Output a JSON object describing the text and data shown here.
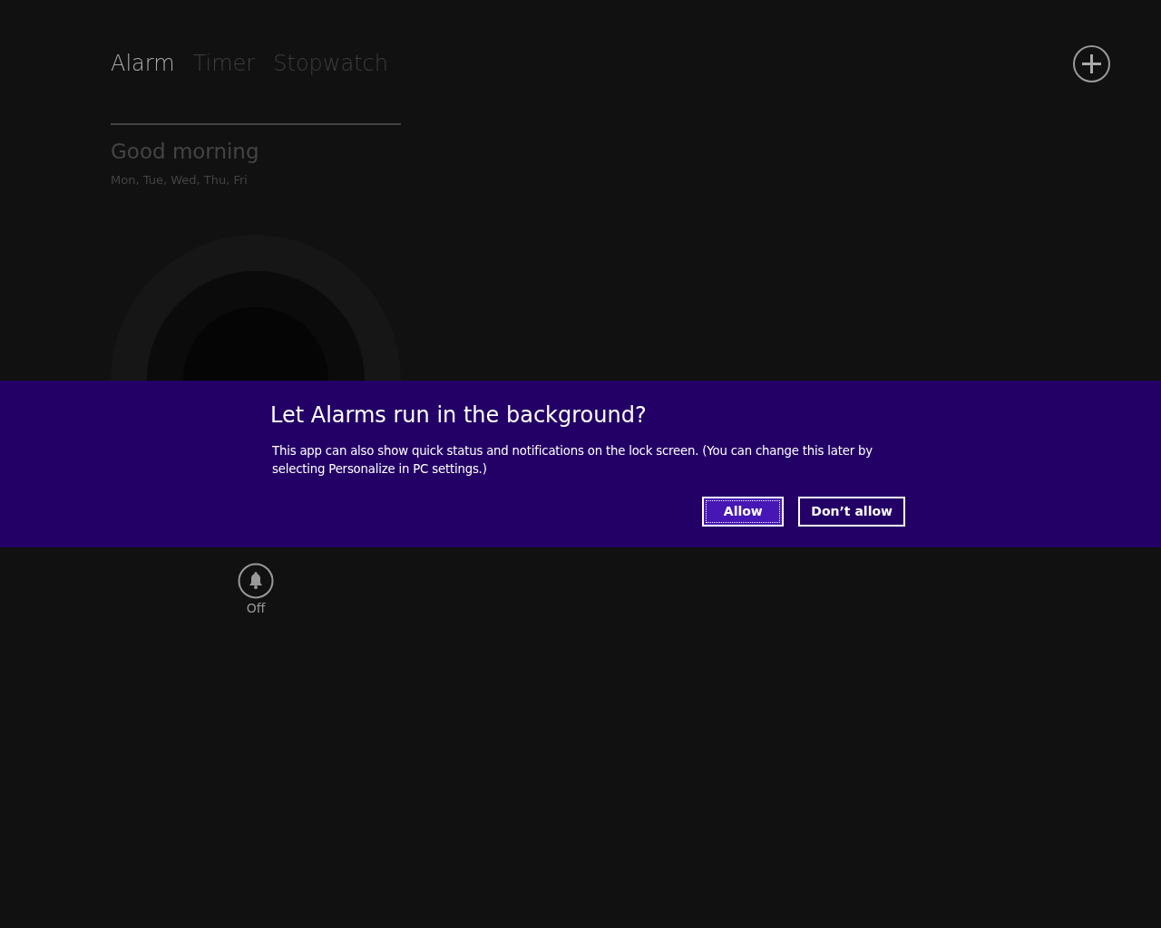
{
  "tabs": [
    {
      "label": "Alarm",
      "selected": true
    },
    {
      "label": "Timer",
      "selected": false
    },
    {
      "label": "Stopwatch",
      "selected": false
    }
  ],
  "alarm": {
    "name": "Good morning",
    "days": "Mon, Tue, Wed, Thu, Fri",
    "on": false,
    "status": "Off"
  },
  "dialog": {
    "title": "Let Alarms run in the background?",
    "message": "This app can also show quick status and notifications on the lock screen. (You can change this later by selecting Personalize in PC settings.)",
    "buttons": [
      {
        "label": "Allow",
        "focused": true
      },
      {
        "label": "Don’t allow",
        "focused": false
      }
    ]
  }
}
